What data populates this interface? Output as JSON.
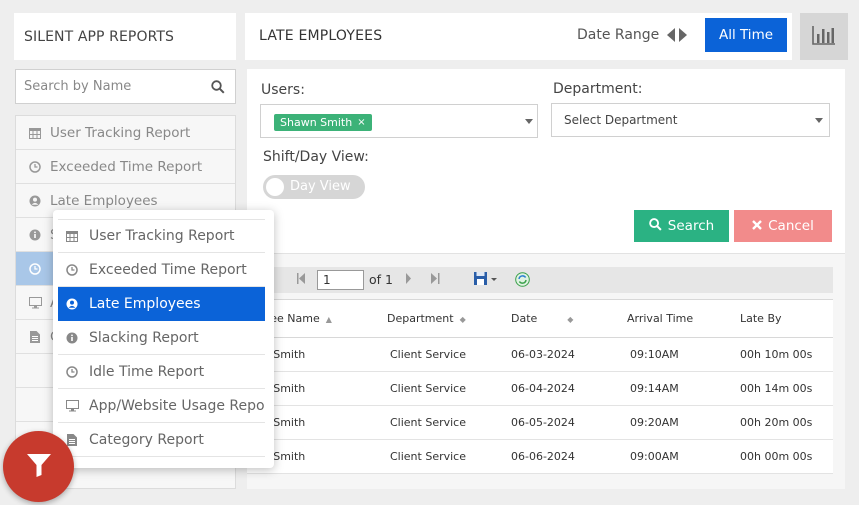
{
  "sidebar": {
    "title": "SILENT APP REPORTS",
    "search_placeholder": "Search by Name",
    "items": [
      {
        "label": "User Tracking Report",
        "icon": "calendar-icon"
      },
      {
        "label": "Exceeded Time Report",
        "icon": "clock-icon"
      },
      {
        "label": "Late Employees",
        "icon": "user-circle-icon"
      },
      {
        "label": "S",
        "icon": "info-icon"
      },
      {
        "label": "",
        "icon": "clock-icon"
      },
      {
        "label": "A",
        "icon": "monitor-icon"
      },
      {
        "label": "C",
        "icon": "document-icon"
      }
    ]
  },
  "header": {
    "title": "LATE EMPLOYEES",
    "date_range_label": "Date Range",
    "all_time_label": "All Time"
  },
  "filters": {
    "users_label": "Users:",
    "selected_user": "Shawn Smith",
    "department_label": "Department:",
    "department_placeholder": "Select Department",
    "shift_label": "Shift/Day View:",
    "toggle_label": "Day View",
    "search_label": "Search",
    "cancel_label": "Cancel"
  },
  "pager": {
    "page": "1",
    "of_label": "of 1"
  },
  "table": {
    "columns": [
      "ployee Name",
      "Department",
      "Date",
      "Arrival Time",
      "Late By"
    ],
    "rows": [
      [
        "awn Smith",
        "Client Service",
        "06-03-2024",
        "09:10AM",
        "00h 10m 00s"
      ],
      [
        "awn Smith",
        "Client Service",
        "06-04-2024",
        "09:14AM",
        "00h 14m 00s"
      ],
      [
        "awn Smith",
        "Client Service",
        "06-05-2024",
        "09:20AM",
        "00h 20m 00s"
      ],
      [
        "awn Smith",
        "Client Service",
        "06-06-2024",
        "09:00AM",
        "00h 00m 00s"
      ]
    ]
  },
  "dropdown": {
    "items": [
      {
        "label": "User Tracking Report",
        "icon": "calendar-icon",
        "active": false
      },
      {
        "label": "Exceeded Time Report",
        "icon": "clock-icon",
        "active": false
      },
      {
        "label": "Late Employees",
        "icon": "user-circle-icon",
        "active": true
      },
      {
        "label": "Slacking Report",
        "icon": "info-icon",
        "active": false
      },
      {
        "label": "Idle Time Report",
        "icon": "clock-icon",
        "active": false
      },
      {
        "label": "App/Website Usage Repo",
        "icon": "monitor-icon",
        "active": false
      },
      {
        "label": "Category Report",
        "icon": "document-icon",
        "active": false
      }
    ]
  },
  "colors": {
    "primary": "#0b63d8",
    "success": "#2bb283",
    "danger_light": "#f28b8b",
    "fab": "#c73a2d"
  }
}
